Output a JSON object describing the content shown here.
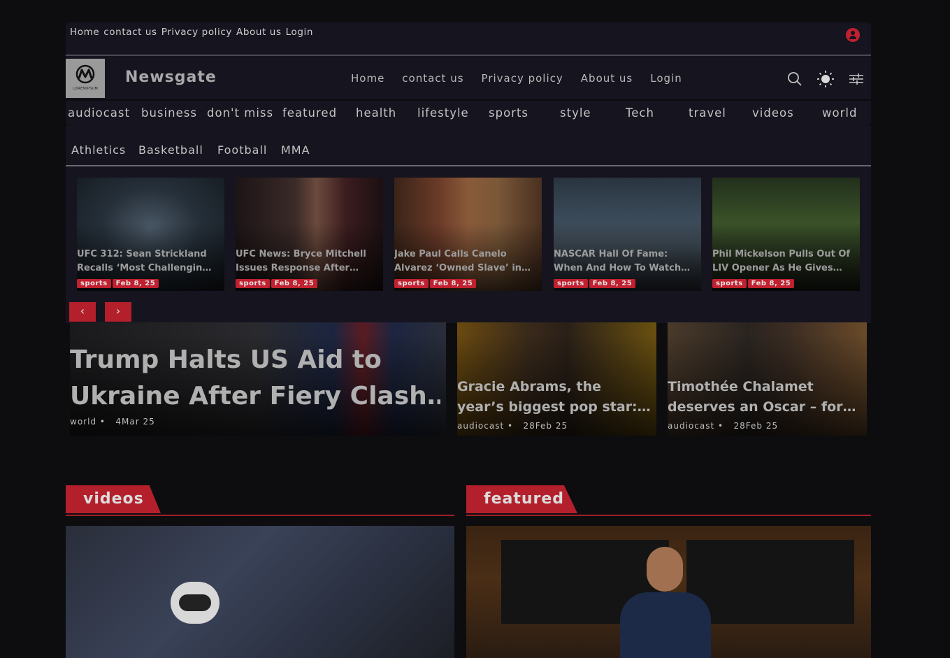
{
  "topbar": {
    "links": [
      "Home",
      "contact us",
      "Privacy policy",
      "About us",
      "Login"
    ]
  },
  "header": {
    "brand": "Newsgate",
    "logo_text": "LOREMIPSUM",
    "nav": [
      "Home",
      "contact us",
      "Privacy policy",
      "About us",
      "Login"
    ]
  },
  "categories": [
    "audiocast",
    "business",
    "don't miss",
    "featured",
    "health",
    "lifestyle",
    "sports",
    "style",
    "Tech",
    "travel",
    "videos",
    "world"
  ],
  "subcategories": [
    "Athletics",
    "Basketball",
    "Football",
    "MMA"
  ],
  "carousel": {
    "prev_label": "‹",
    "next_label": "›",
    "cards": [
      {
        "title1": "UFC 312: Sean Strickland",
        "title2": "Recalls ‘Most Challengin…",
        "category": "sports",
        "date": "Feb 8, 25"
      },
      {
        "title1": "UFC News: Bryce Mitchell",
        "title2": "Issues Response After…",
        "category": "sports",
        "date": "Feb 8, 25"
      },
      {
        "title1": "Jake Paul Calls Canelo",
        "title2": "Alvarez ‘Owned Slave’ in…",
        "category": "sports",
        "date": "Feb 8, 25"
      },
      {
        "title1": "NASCAR Hall Of Fame:",
        "title2": "When And How To Watch…",
        "category": "sports",
        "date": "Feb 8, 25"
      },
      {
        "title1": "Phil Mickelson Pulls Out Of",
        "title2": "LIV Opener As He Gives…",
        "category": "sports",
        "date": "Feb 8, 25"
      }
    ]
  },
  "hero": {
    "main": {
      "line1": "Trump Halts US Aid to",
      "line2": "Ukraine After Fiery Clash…",
      "category": "world",
      "date": "4Mar 25"
    },
    "side": [
      {
        "line1": "Gracie Abrams, the",
        "line2": "year’s biggest pop star:…",
        "category": "audiocast",
        "date": "28Feb 25"
      },
      {
        "line1": "Timothée Chalamet",
        "line2": "deserves an Oscar – for…",
        "category": "audiocast",
        "date": "28Feb 25"
      }
    ]
  },
  "sections": {
    "videos": "videos",
    "featured": "featured"
  },
  "colors": {
    "accent": "#b3202c",
    "panel": "#15141f",
    "background": "#0d0d0f"
  }
}
